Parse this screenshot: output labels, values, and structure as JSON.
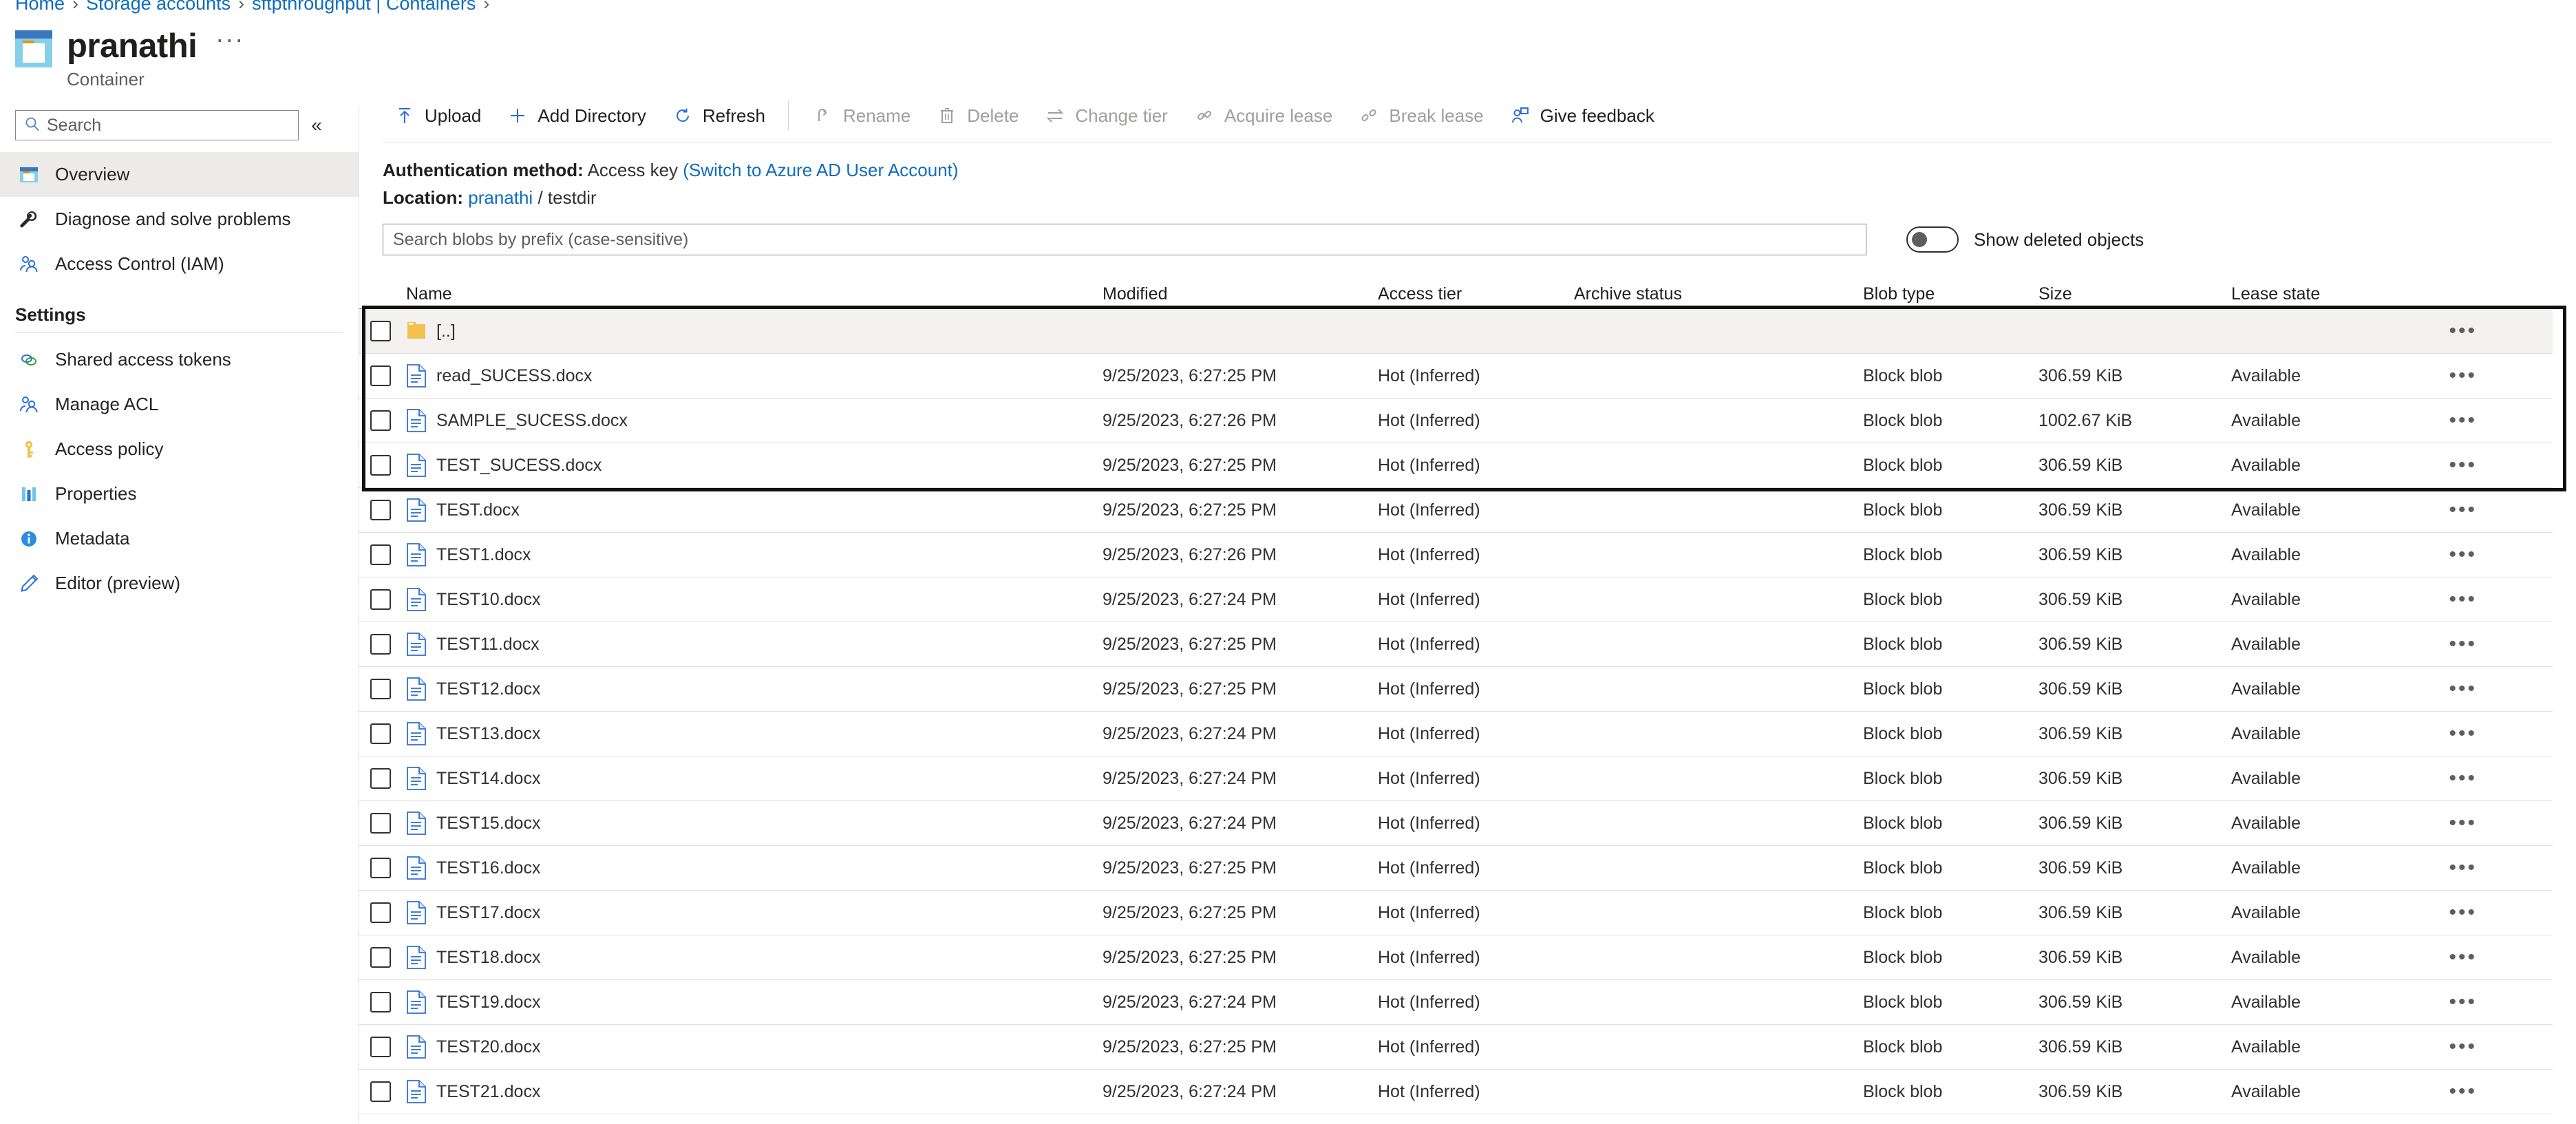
{
  "breadcrumb": {
    "items": [
      {
        "label": "Home",
        "link": true
      },
      {
        "label": "Storage accounts",
        "link": true
      },
      {
        "label": "sftpthroughput | Containers",
        "link": true
      }
    ],
    "separator": "›"
  },
  "header": {
    "title": "pranathi",
    "subtitle": "Container",
    "more_label": "···",
    "icon": "container-icon"
  },
  "sidebar": {
    "search": {
      "placeholder": "Search",
      "value": "",
      "icon": "search-icon"
    },
    "collapse_label": "«",
    "items": [
      {
        "label": "Overview",
        "icon": "container-icon",
        "active": true
      },
      {
        "label": "Diagnose and solve problems",
        "icon": "wrench-icon",
        "active": false
      },
      {
        "label": "Access Control (IAM)",
        "icon": "people-icon",
        "active": false
      }
    ],
    "groups": [
      {
        "label": "Settings",
        "items": [
          {
            "label": "Shared access tokens",
            "icon": "link-rings-icon"
          },
          {
            "label": "Manage ACL",
            "icon": "people-icon"
          },
          {
            "label": "Access policy",
            "icon": "key-icon"
          },
          {
            "label": "Properties",
            "icon": "bars-icon"
          },
          {
            "label": "Metadata",
            "icon": "info-icon"
          },
          {
            "label": "Editor (preview)",
            "icon": "pencil-icon"
          }
        ]
      }
    ]
  },
  "toolbar": {
    "items": [
      {
        "label": "Upload",
        "icon": "upload-arrow-icon",
        "disabled": false
      },
      {
        "label": "Add Directory",
        "icon": "plus-icon",
        "disabled": false
      },
      {
        "label": "Refresh",
        "icon": "refresh-icon",
        "disabled": false
      },
      {
        "separator": true
      },
      {
        "label": "Rename",
        "icon": "rename-icon",
        "disabled": true
      },
      {
        "label": "Delete",
        "icon": "trash-icon",
        "disabled": true
      },
      {
        "label": "Change tier",
        "icon": "swap-arrows-icon",
        "disabled": true
      },
      {
        "label": "Acquire lease",
        "icon": "lease-icon",
        "disabled": true
      },
      {
        "label": "Break lease",
        "icon": "break-lease-icon",
        "disabled": true
      },
      {
        "label": "Give feedback",
        "icon": "feedback-person-icon",
        "disabled": false
      }
    ]
  },
  "info": {
    "auth_label": "Authentication method:",
    "auth_value": "Access key",
    "auth_switch_link": "(Switch to Azure AD User Account)",
    "location_label": "Location:",
    "location_container": "pranathi",
    "location_sep": "/",
    "location_dir": "testdir"
  },
  "filters": {
    "search_placeholder": "Search blobs by prefix (case-sensitive)",
    "search_value": "",
    "show_deleted_label": "Show deleted objects",
    "show_deleted_on": false
  },
  "table": {
    "columns": [
      "Name",
      "Modified",
      "Access tier",
      "Archive status",
      "Blob type",
      "Size",
      "Lease state"
    ],
    "row_menu_glyph": "•••",
    "rows": [
      {
        "name": "[..]",
        "kind": "folder",
        "modified": "",
        "tier": "",
        "archive": "",
        "blob_type": "",
        "size": "",
        "lease": "",
        "highlighted": true
      },
      {
        "name": "read_SUCESS.docx",
        "kind": "file",
        "modified": "9/25/2023, 6:27:25 PM",
        "tier": "Hot (Inferred)",
        "archive": "",
        "blob_type": "Block blob",
        "size": "306.59 KiB",
        "lease": "Available",
        "highlighted": true
      },
      {
        "name": "SAMPLE_SUCESS.docx",
        "kind": "file",
        "modified": "9/25/2023, 6:27:26 PM",
        "tier": "Hot (Inferred)",
        "archive": "",
        "blob_type": "Block blob",
        "size": "1002.67 KiB",
        "lease": "Available",
        "highlighted": true
      },
      {
        "name": "TEST_SUCESS.docx",
        "kind": "file",
        "modified": "9/25/2023, 6:27:25 PM",
        "tier": "Hot (Inferred)",
        "archive": "",
        "blob_type": "Block blob",
        "size": "306.59 KiB",
        "lease": "Available",
        "highlighted": true
      },
      {
        "name": "TEST.docx",
        "kind": "file",
        "modified": "9/25/2023, 6:27:25 PM",
        "tier": "Hot (Inferred)",
        "archive": "",
        "blob_type": "Block blob",
        "size": "306.59 KiB",
        "lease": "Available",
        "highlighted": false
      },
      {
        "name": "TEST1.docx",
        "kind": "file",
        "modified": "9/25/2023, 6:27:26 PM",
        "tier": "Hot (Inferred)",
        "archive": "",
        "blob_type": "Block blob",
        "size": "306.59 KiB",
        "lease": "Available",
        "highlighted": false
      },
      {
        "name": "TEST10.docx",
        "kind": "file",
        "modified": "9/25/2023, 6:27:24 PM",
        "tier": "Hot (Inferred)",
        "archive": "",
        "blob_type": "Block blob",
        "size": "306.59 KiB",
        "lease": "Available",
        "highlighted": false
      },
      {
        "name": "TEST11.docx",
        "kind": "file",
        "modified": "9/25/2023, 6:27:25 PM",
        "tier": "Hot (Inferred)",
        "archive": "",
        "blob_type": "Block blob",
        "size": "306.59 KiB",
        "lease": "Available",
        "highlighted": false
      },
      {
        "name": "TEST12.docx",
        "kind": "file",
        "modified": "9/25/2023, 6:27:25 PM",
        "tier": "Hot (Inferred)",
        "archive": "",
        "blob_type": "Block blob",
        "size": "306.59 KiB",
        "lease": "Available",
        "highlighted": false
      },
      {
        "name": "TEST13.docx",
        "kind": "file",
        "modified": "9/25/2023, 6:27:24 PM",
        "tier": "Hot (Inferred)",
        "archive": "",
        "blob_type": "Block blob",
        "size": "306.59 KiB",
        "lease": "Available",
        "highlighted": false
      },
      {
        "name": "TEST14.docx",
        "kind": "file",
        "modified": "9/25/2023, 6:27:24 PM",
        "tier": "Hot (Inferred)",
        "archive": "",
        "blob_type": "Block blob",
        "size": "306.59 KiB",
        "lease": "Available",
        "highlighted": false
      },
      {
        "name": "TEST15.docx",
        "kind": "file",
        "modified": "9/25/2023, 6:27:24 PM",
        "tier": "Hot (Inferred)",
        "archive": "",
        "blob_type": "Block blob",
        "size": "306.59 KiB",
        "lease": "Available",
        "highlighted": false
      },
      {
        "name": "TEST16.docx",
        "kind": "file",
        "modified": "9/25/2023, 6:27:25 PM",
        "tier": "Hot (Inferred)",
        "archive": "",
        "blob_type": "Block blob",
        "size": "306.59 KiB",
        "lease": "Available",
        "highlighted": false
      },
      {
        "name": "TEST17.docx",
        "kind": "file",
        "modified": "9/25/2023, 6:27:25 PM",
        "tier": "Hot (Inferred)",
        "archive": "",
        "blob_type": "Block blob",
        "size": "306.59 KiB",
        "lease": "Available",
        "highlighted": false
      },
      {
        "name": "TEST18.docx",
        "kind": "file",
        "modified": "9/25/2023, 6:27:25 PM",
        "tier": "Hot (Inferred)",
        "archive": "",
        "blob_type": "Block blob",
        "size": "306.59 KiB",
        "lease": "Available",
        "highlighted": false
      },
      {
        "name": "TEST19.docx",
        "kind": "file",
        "modified": "9/25/2023, 6:27:24 PM",
        "tier": "Hot (Inferred)",
        "archive": "",
        "blob_type": "Block blob",
        "size": "306.59 KiB",
        "lease": "Available",
        "highlighted": false
      },
      {
        "name": "TEST20.docx",
        "kind": "file",
        "modified": "9/25/2023, 6:27:25 PM",
        "tier": "Hot (Inferred)",
        "archive": "",
        "blob_type": "Block blob",
        "size": "306.59 KiB",
        "lease": "Available",
        "highlighted": false
      },
      {
        "name": "TEST21.docx",
        "kind": "file",
        "modified": "9/25/2023, 6:27:24 PM",
        "tier": "Hot (Inferred)",
        "archive": "",
        "blob_type": "Block blob",
        "size": "306.59 KiB",
        "lease": "Available",
        "highlighted": false
      }
    ]
  },
  "colors": {
    "accent": "#0f6cbd",
    "link": "#0f6cbd",
    "selection_border": "#111111",
    "row_selected_bg": "#f3f2f1",
    "folder": "#f2c14e"
  }
}
